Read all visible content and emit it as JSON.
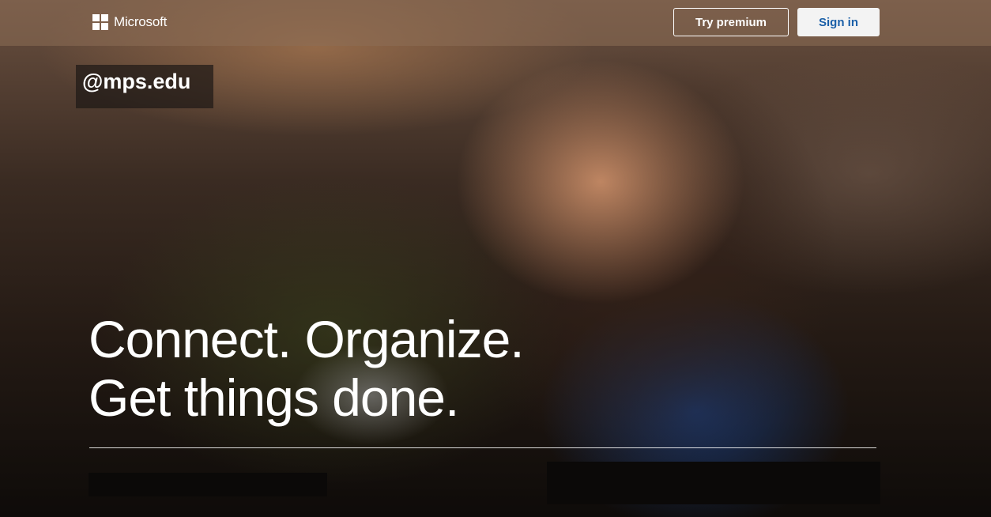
{
  "header": {
    "brand": "Microsoft",
    "try_premium_label": "Try premium",
    "sign_in_label": "Sign in"
  },
  "overlay": {
    "domain_label": "@mps.edu"
  },
  "hero": {
    "headline_line1": "Connect. Organize.",
    "headline_line2": "Get things done."
  },
  "icons": {
    "logo": "microsoft-logo-icon"
  },
  "colors": {
    "sign_in_text": "#1a5fa8",
    "sign_in_bg": "#f3f3f3",
    "text": "#ffffff"
  }
}
